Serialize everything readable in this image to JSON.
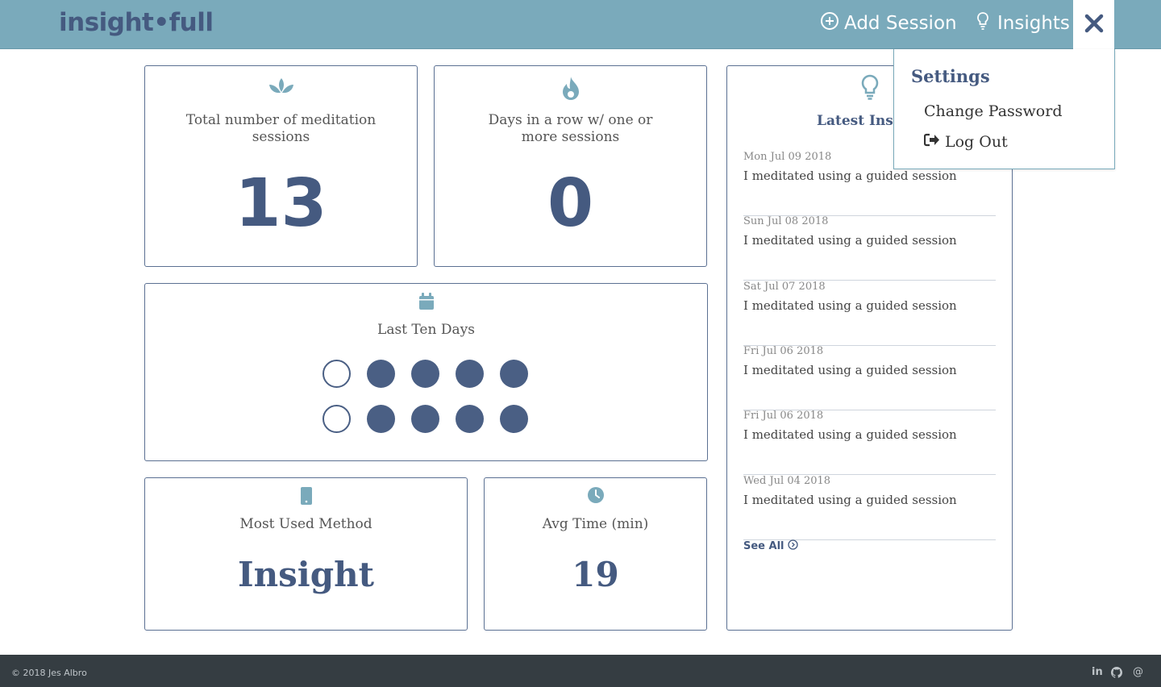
{
  "header": {
    "logo": "insight•full",
    "add_session": "Add Session",
    "insights": "Insights",
    "close": "✕"
  },
  "cards": {
    "total": {
      "label": "Total number of meditation sessions",
      "value": "13",
      "icon": "lotus-icon"
    },
    "streak": {
      "label": "Days in a row w/ one or more sessions",
      "value": "0",
      "icon": "flame-icon"
    },
    "last_ten": {
      "label": "Last Ten Days",
      "icon": "calendar-icon",
      "days": [
        false,
        true,
        true,
        true,
        true,
        false,
        true,
        true,
        true,
        true
      ]
    },
    "method": {
      "label": "Most Used Method",
      "value": "Insight",
      "icon": "phone-icon"
    },
    "avg_time": {
      "label": "Avg Time (min)",
      "value": "19",
      "icon": "clock-icon"
    }
  },
  "insights": {
    "title": "Latest Insig",
    "icon": "lightbulb-icon",
    "entries": [
      {
        "date": "Mon Jul 09 2018",
        "text": "I meditated using a guided session"
      },
      {
        "date": "Sun Jul 08 2018",
        "text": "I meditated using a guided session"
      },
      {
        "date": "Sat Jul 07 2018",
        "text": "I meditated using a guided session"
      },
      {
        "date": "Fri Jul 06 2018",
        "text": "I meditated using a guided session"
      },
      {
        "date": "Fri Jul 06 2018",
        "text": "I meditated using a guided session"
      },
      {
        "date": "Wed Jul 04 2018",
        "text": "I meditated using a guided session"
      }
    ],
    "see_all": "See All"
  },
  "dropdown": {
    "title": "Settings",
    "change_password": "Change Password",
    "log_out": "Log Out"
  },
  "footer": {
    "copyright": "© 2018 Jes Albro",
    "linkedin": "in",
    "at": "@"
  },
  "colors": {
    "header_bg": "#7aaabb",
    "accent_navy": "#455a80",
    "icon_blue": "#7aaabb",
    "footer_bg": "#353d42"
  }
}
